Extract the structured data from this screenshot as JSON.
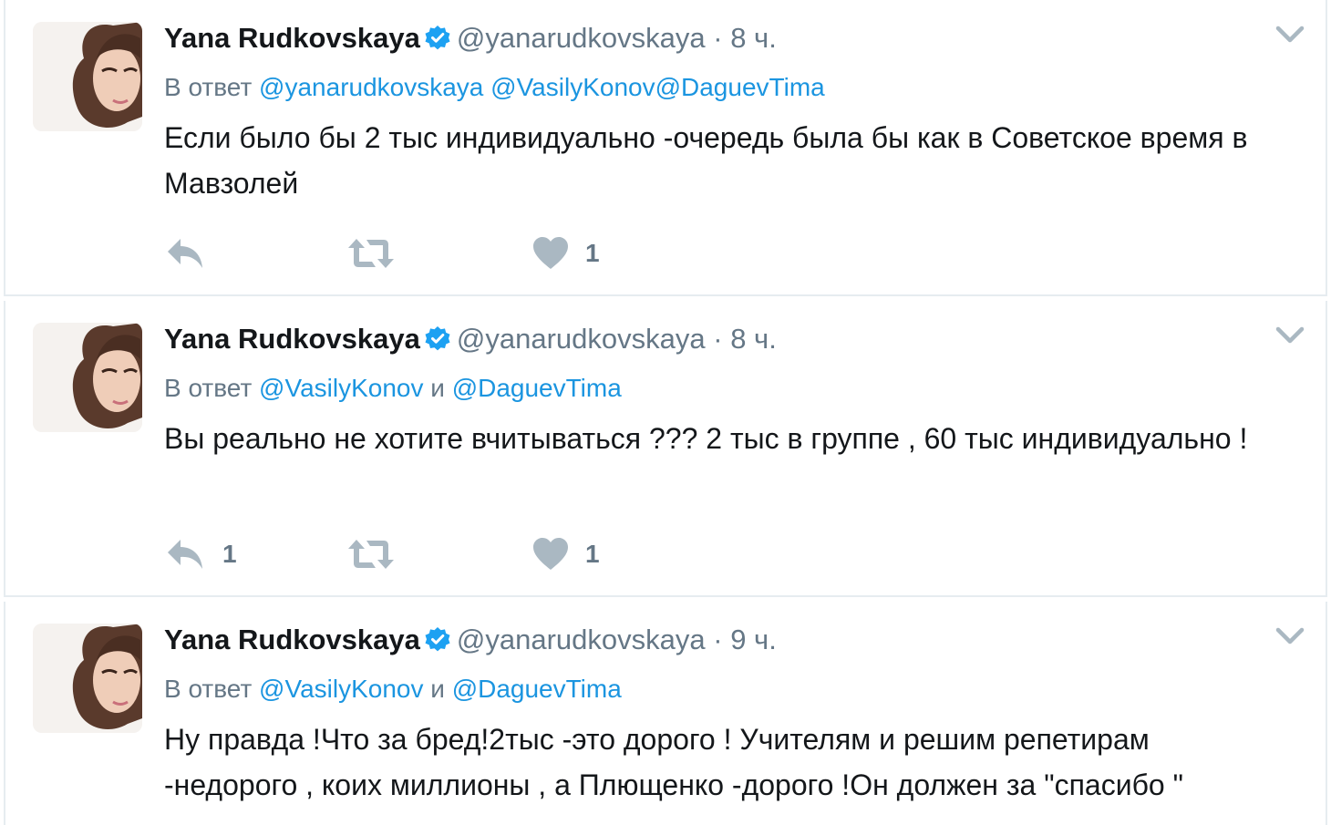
{
  "tweets": [
    {
      "fullname": "Yana Rudkovskaya",
      "username": "@yanarudkovskaya",
      "dot": "·",
      "time": "8 ч.",
      "reply_prefix": "В ответ",
      "mentions": [
        "@yanarudkovskaya",
        "@VasilyKonov",
        "@DaguevTima"
      ],
      "joiners": [
        " ",
        "",
        ""
      ],
      "text": "Если было бы 2 тыс индивидуально -очередь была бы как в Советское время в Мавзолей",
      "reply_count": "",
      "retweet_count": "",
      "like_count": "1"
    },
    {
      "fullname": "Yana Rudkovskaya",
      "username": "@yanarudkovskaya",
      "dot": "·",
      "time": "8 ч.",
      "reply_prefix": "В ответ",
      "mentions": [
        "@VasilyKonov",
        "@DaguevTima"
      ],
      "joiners": [
        " и ",
        ""
      ],
      "text": "Вы реально не хотите вчитываться ??? 2 тыс в группе , 60 тыс индивидуально !",
      "reply_count": "1",
      "retweet_count": "",
      "like_count": "1"
    },
    {
      "fullname": "Yana Rudkovskaya",
      "username": "@yanarudkovskaya",
      "dot": "·",
      "time": "9 ч.",
      "reply_prefix": "В ответ",
      "mentions": [
        "@VasilyKonov",
        "@DaguevTima"
      ],
      "joiners": [
        " и ",
        ""
      ],
      "text": "Ну правда !Что за бред!2тыс -это дорого ! Учителям и решим репетирам -недорого , коих миллионы , а Плющенко -дорого !Он должен за \"спасибо \"",
      "reply_count": "",
      "retweet_count": "",
      "like_count": ""
    }
  ],
  "icons": {
    "verified": "verified-badge-icon",
    "caret": "chevron-down-icon",
    "reply": "reply-icon",
    "retweet": "retweet-icon",
    "like": "heart-icon"
  },
  "colors": {
    "mention": "#1b95e0",
    "secondary": "#657786",
    "verified": "#1da1f2",
    "action_icon": "#aab8c2",
    "border": "#e6ecf0"
  }
}
